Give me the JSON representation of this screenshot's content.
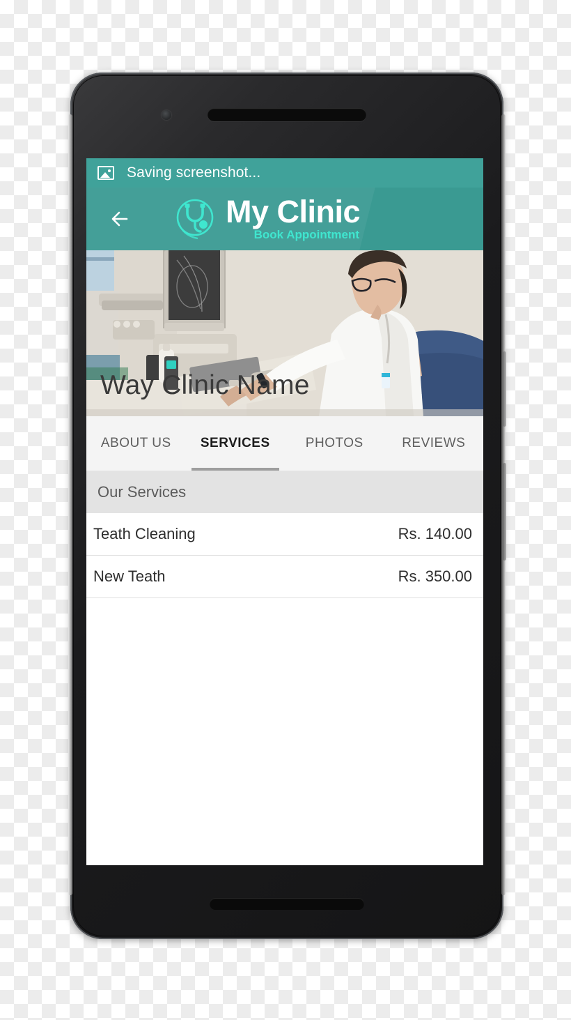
{
  "status_bar": {
    "icon": "image-icon",
    "text": "Saving screenshot..."
  },
  "app_bar": {
    "back_icon": "back-arrow-icon",
    "logo_icon": "stethoscope-circle-icon",
    "title": "My Clinic",
    "subtitle": "Book Appointment"
  },
  "hero": {
    "overlay_title": "Way Clinic Name",
    "image_description": "doctor-at-ultrasound-machine"
  },
  "tabs": [
    {
      "label": "ABOUT US",
      "active": false
    },
    {
      "label": "SERVICES",
      "active": true
    },
    {
      "label": "PHOTOS",
      "active": false
    },
    {
      "label": "REVIEWS",
      "active": false
    }
  ],
  "section": {
    "header": "Our Services"
  },
  "services": [
    {
      "name": "Teath Cleaning",
      "price": "Rs. 140.00"
    },
    {
      "name": "New Teath",
      "price": "Rs. 350.00"
    }
  ],
  "colors": {
    "status_bar": "#40a29a",
    "app_bar": "#3a9a92",
    "accent_mint": "#3fe6cf",
    "section_band": "#e3e3e3",
    "tab_bar": "#f4f4f4",
    "tab_indicator": "#9e9e9e"
  },
  "device": {
    "hardware": [
      "front-camera",
      "earpiece-speaker",
      "bottom-speaker",
      "volume-rocker",
      "power-button"
    ]
  }
}
